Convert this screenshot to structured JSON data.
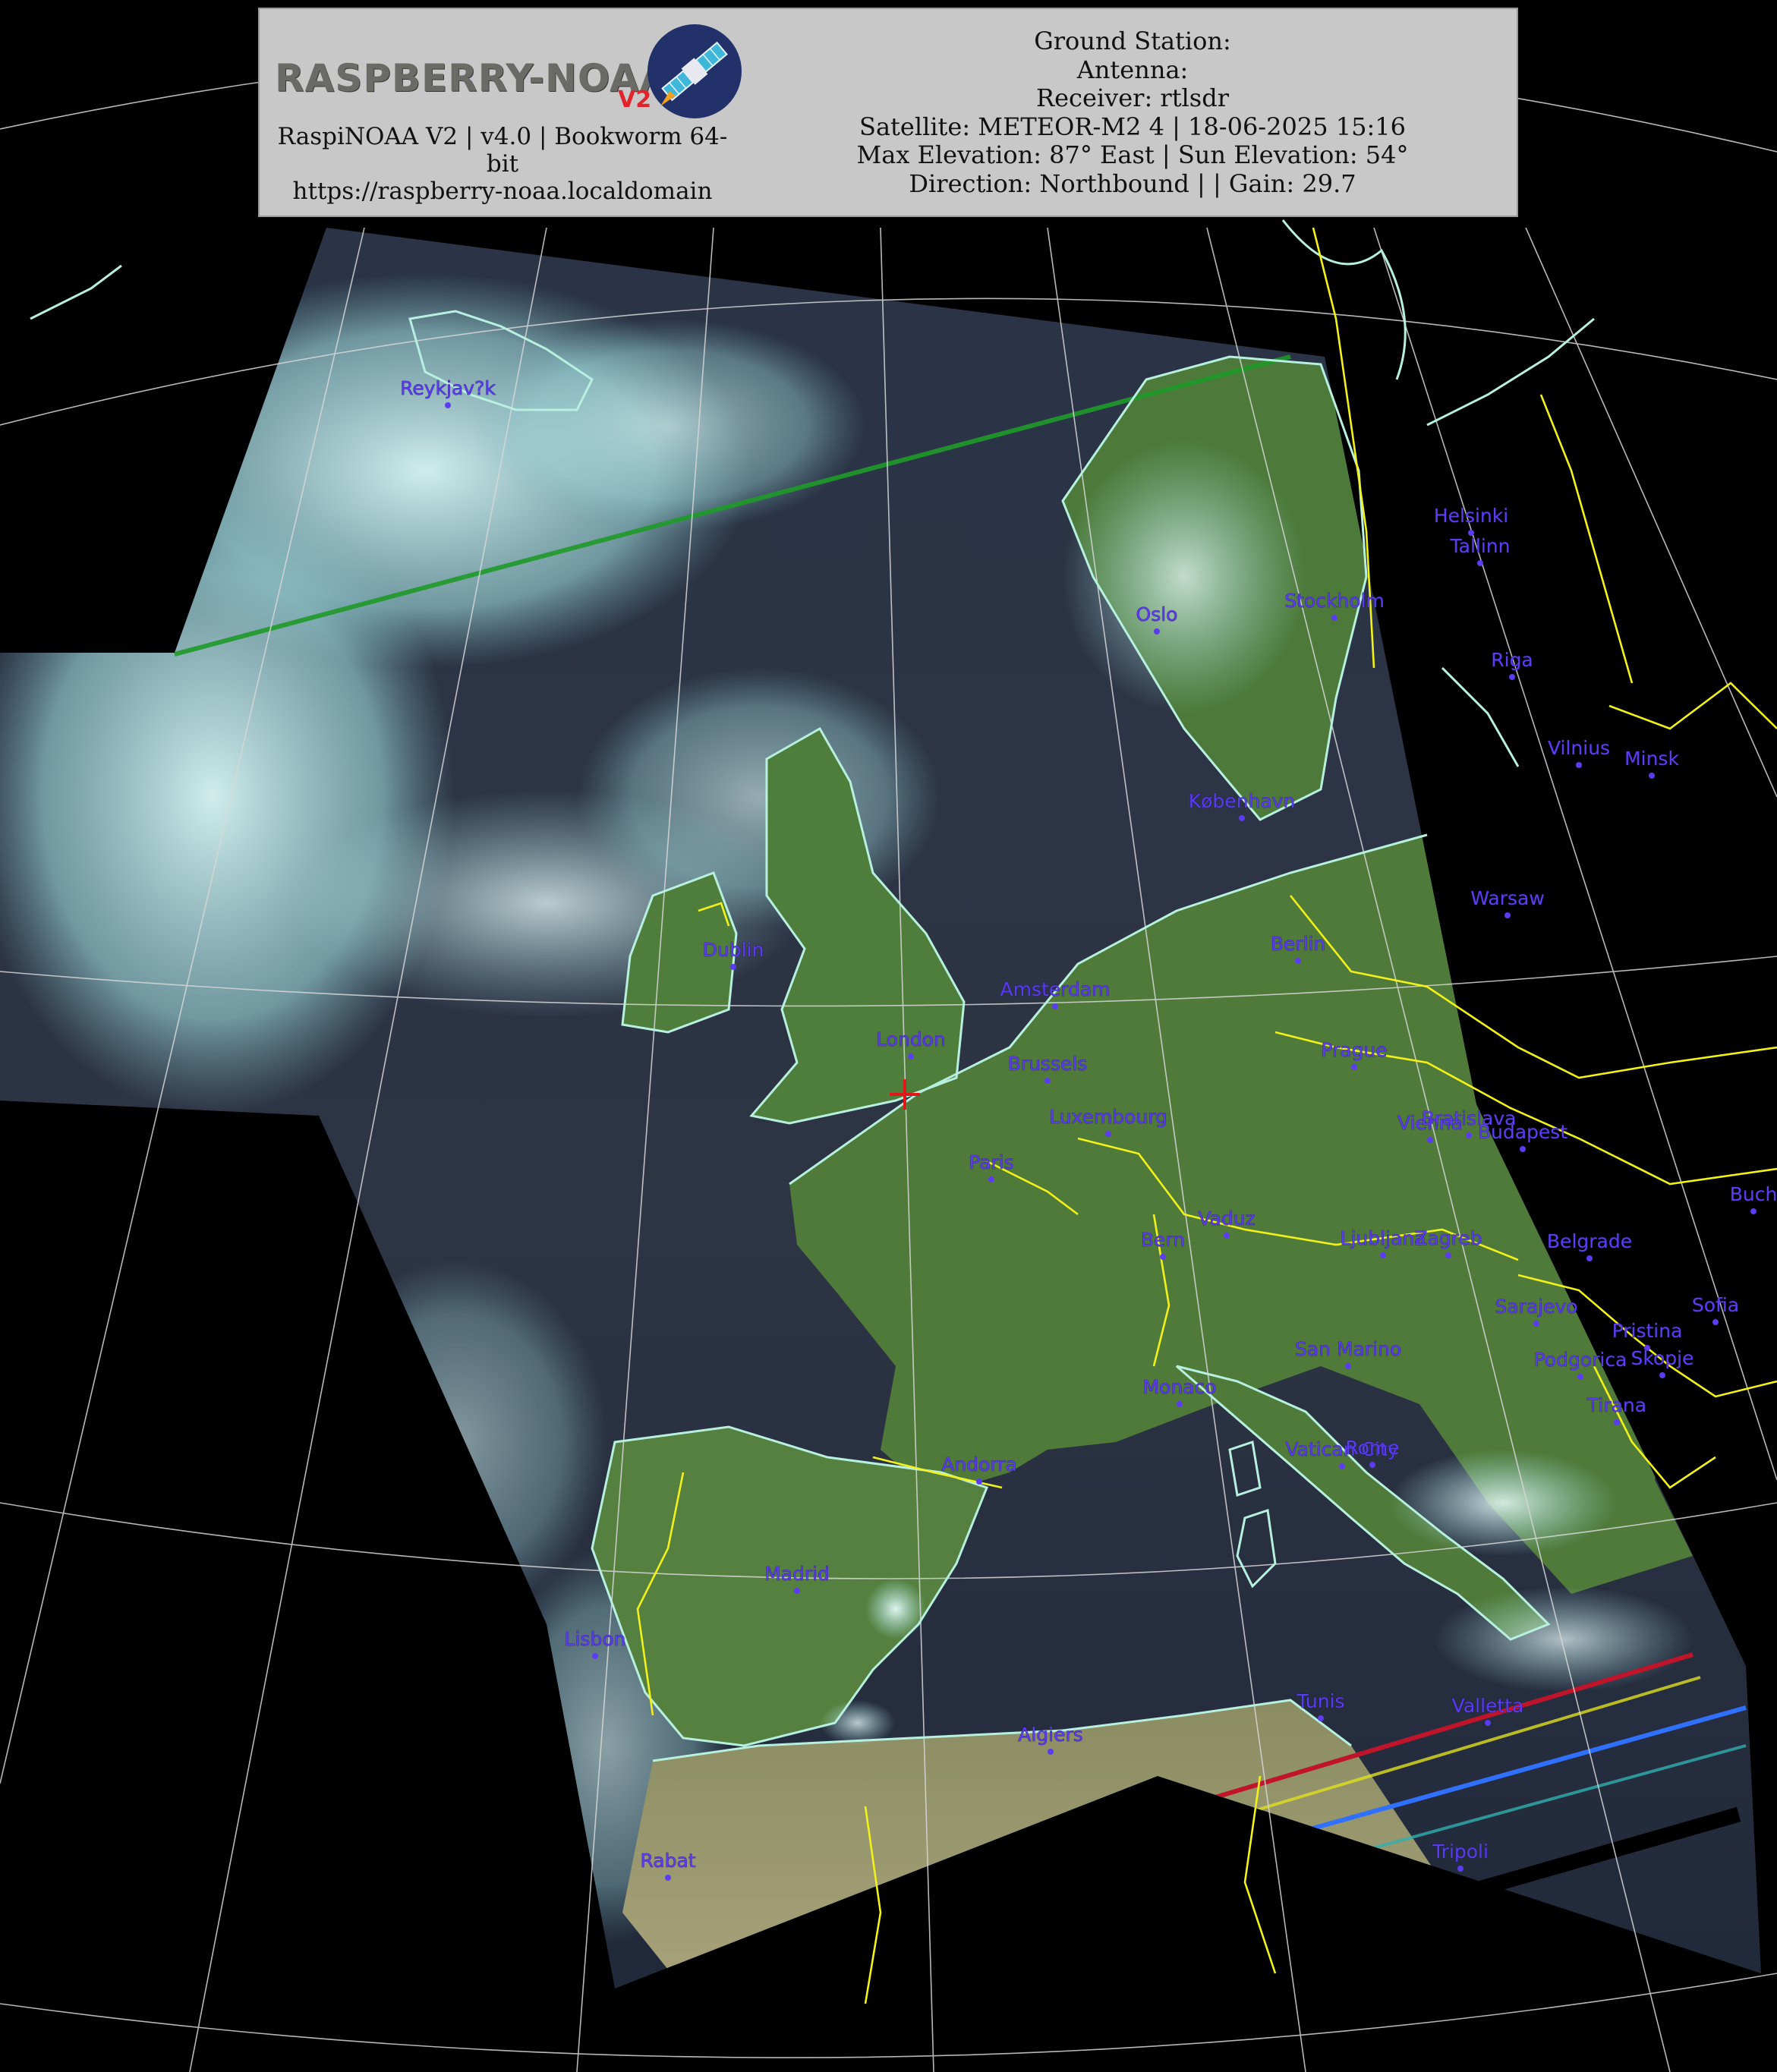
{
  "header": {
    "logo_text": "RASPBERRY-NOAA",
    "logo_v2": "V2",
    "software_line1": "RaspiNOAA V2 | v4.0 | Bookworm 64-",
    "software_line2": "bit",
    "url": "https://raspberry-noaa.localdomain",
    "ground_station": "Ground Station:",
    "antenna": "Antenna:",
    "receiver": "Receiver: rtlsdr",
    "satellite": "Satellite: METEOR-M2 4 | 18-06-2025 15:16",
    "elevation": "Max Elevation: 87° East | Sun Elevation: 54°",
    "direction": "Direction: Northbound | | Gain: 29.7"
  },
  "colors": {
    "background": "#000000",
    "header_bg": "#c8c8c8",
    "coastline": "#b8f0e0",
    "border": "#f2f21a",
    "city_label": "#5b3cf0",
    "graticule": "#d8d8d8",
    "land": "#4f7a3a",
    "sea": "#1c2535",
    "cloud": "#a9e8ea",
    "station_marker": "#e01818"
  },
  "cities": [
    {
      "name": "Reykjav?k"
    },
    {
      "name": "Helsinki"
    },
    {
      "name": "Tallinn"
    },
    {
      "name": "Oslo"
    },
    {
      "name": "Stockholm"
    },
    {
      "name": "Riga"
    },
    {
      "name": "Vilnius"
    },
    {
      "name": "Minsk"
    },
    {
      "name": "København"
    },
    {
      "name": "Warsaw"
    },
    {
      "name": "Dublin"
    },
    {
      "name": "Berlin"
    },
    {
      "name": "Amsterdam"
    },
    {
      "name": "London"
    },
    {
      "name": "Brussels"
    },
    {
      "name": "Prague"
    },
    {
      "name": "Luxembourg"
    },
    {
      "name": "Vienna"
    },
    {
      "name": "Bratislava"
    },
    {
      "name": "Budapest"
    },
    {
      "name": "Paris"
    },
    {
      "name": "Vaduz"
    },
    {
      "name": "Bern"
    },
    {
      "name": "Ljubljana"
    },
    {
      "name": "Zagreb"
    },
    {
      "name": "Belgrade"
    },
    {
      "name": "Buch"
    },
    {
      "name": "Sarajevo"
    },
    {
      "name": "Sofia"
    },
    {
      "name": "Pristina"
    },
    {
      "name": "San Marino"
    },
    {
      "name": "Podgorica"
    },
    {
      "name": "Skopje"
    },
    {
      "name": "Monaco"
    },
    {
      "name": "Tirana"
    },
    {
      "name": "Andorra"
    },
    {
      "name": "Vatican City"
    },
    {
      "name": "Rome"
    },
    {
      "name": "Madrid"
    },
    {
      "name": "Lisbon"
    },
    {
      "name": "Tunis"
    },
    {
      "name": "Valletta"
    },
    {
      "name": "Algiers"
    },
    {
      "name": "Tripoli"
    },
    {
      "name": "Rabat"
    }
  ]
}
